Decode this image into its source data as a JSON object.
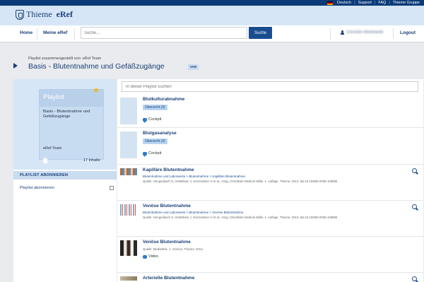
{
  "topbar": {
    "language": "Deutsch",
    "links": [
      "Support",
      "FAQ",
      "Thieme Gruppe"
    ]
  },
  "brand": {
    "name": "Thieme",
    "product": "eRef"
  },
  "nav": {
    "home": "Home",
    "my_eref": "Meine eRef",
    "search_placeholder": "Suche...",
    "search_button": "Suche",
    "user_name": "Christin Reinhardt",
    "logout": "Logout"
  },
  "playlist": {
    "creator": "Playlist zusammengestellt von: eRef Team",
    "title": "Basis - Blutentnahme und Gefäßzugänge",
    "badge": "VAR",
    "filter_placeholder": "In dieser Playlist suchen"
  },
  "sidebar": {
    "card_label": "Playlist",
    "card_title": "Basis - Blutentnahme und Gefäßzugänge",
    "owner": "eRef Team",
    "count": "17 Inhalte",
    "subscribe_heading": "PLAYLIST ABONNIEREN",
    "subscribe_label": "Playlist abonnieren"
  },
  "items": [
    {
      "title": "Blutkulturabnahme",
      "pill": "Übersicht (3)",
      "cockpit": "Cockpit"
    },
    {
      "title": "Blutgasanalyse",
      "pill": "Übersicht (3)",
      "cockpit": "Cockpit"
    },
    {
      "title": "Kapilläre Blutentnahme",
      "breadcrumb": "Blutentnahme und Laborwerte > Blutentnahme > Kapilläre Blutentnahme",
      "source": "Quelle: Hengesbach S, Hinkelbein J, Genzwürker H et al., Hrsg. Checkliste Medical Skills. 1. Auflage. Thieme; 2013. doi:10.1055/b-0035-108585"
    },
    {
      "title": "Venöse Blutentnahme",
      "breadcrumb": "Blutentnahme und Laborwerte > Blutentnahme > Venöse Blutentnahme",
      "source": "Quelle: Hengesbach S, Hinkelbein J, Genzwürker H et al., Hrsg. Checkliste Medical Skills. 1. Auflage. Thieme; 2013. doi:10.1055/b-0035-108586"
    },
    {
      "title": "Venöse Blutentnahme",
      "source": "Quelle: Mediathek. 1. Version. Thieme; 2014.",
      "media": "Video"
    },
    {
      "title": "Arterielle Blutentnahme"
    }
  ],
  "colors": {
    "navy": "#0a3a78",
    "brand_blue": "#1a3f78",
    "light_blue": "#d6e6f6",
    "star": "#f2b211"
  }
}
